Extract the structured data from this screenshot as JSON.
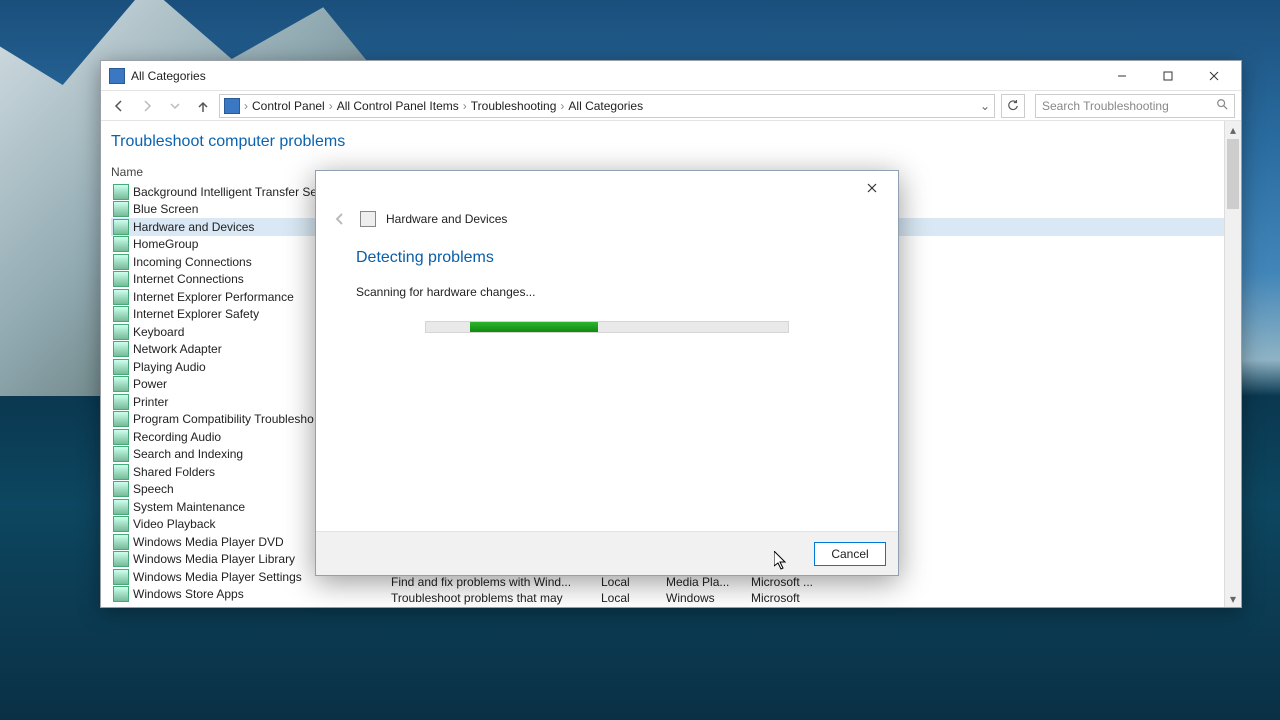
{
  "window": {
    "title": "All Categories",
    "min_tip": "Minimize",
    "max_tip": "Maximize",
    "close_tip": "Close"
  },
  "breadcrumbs": [
    "Control Panel",
    "All Control Panel Items",
    "Troubleshooting",
    "All Categories"
  ],
  "search": {
    "placeholder": "Search Troubleshooting"
  },
  "headline": "Troubleshoot computer problems",
  "column_header": "Name",
  "list": {
    "selected_index": 2,
    "items": [
      "Background Intelligent Transfer Se",
      "Blue Screen",
      "Hardware and Devices",
      "HomeGroup",
      "Incoming Connections",
      "Internet Connections",
      "Internet Explorer Performance",
      "Internet Explorer Safety",
      "Keyboard",
      "Network Adapter",
      "Playing Audio",
      "Power",
      "Printer",
      "Program Compatibility Troublesho",
      "Recording Audio",
      "Search and Indexing",
      "Shared Folders",
      "Speech",
      "System Maintenance",
      "Video Playback",
      "Windows Media Player DVD",
      "Windows Media Player Library",
      "Windows Media Player Settings",
      "Windows Store Apps"
    ]
  },
  "detail_rows": [
    {
      "desc": "Find and fix problems with Wind...",
      "loc": "Local",
      "cat": "Media Pla...",
      "pub": "Microsoft ..."
    },
    {
      "desc": "Troubleshoot problems that may",
      "loc": "Local",
      "cat": "Windows",
      "pub": "Microsoft"
    }
  ],
  "dialog": {
    "name": "Hardware and Devices",
    "title": "Detecting problems",
    "message": "Scanning for hardware changes...",
    "cancel": "Cancel"
  }
}
